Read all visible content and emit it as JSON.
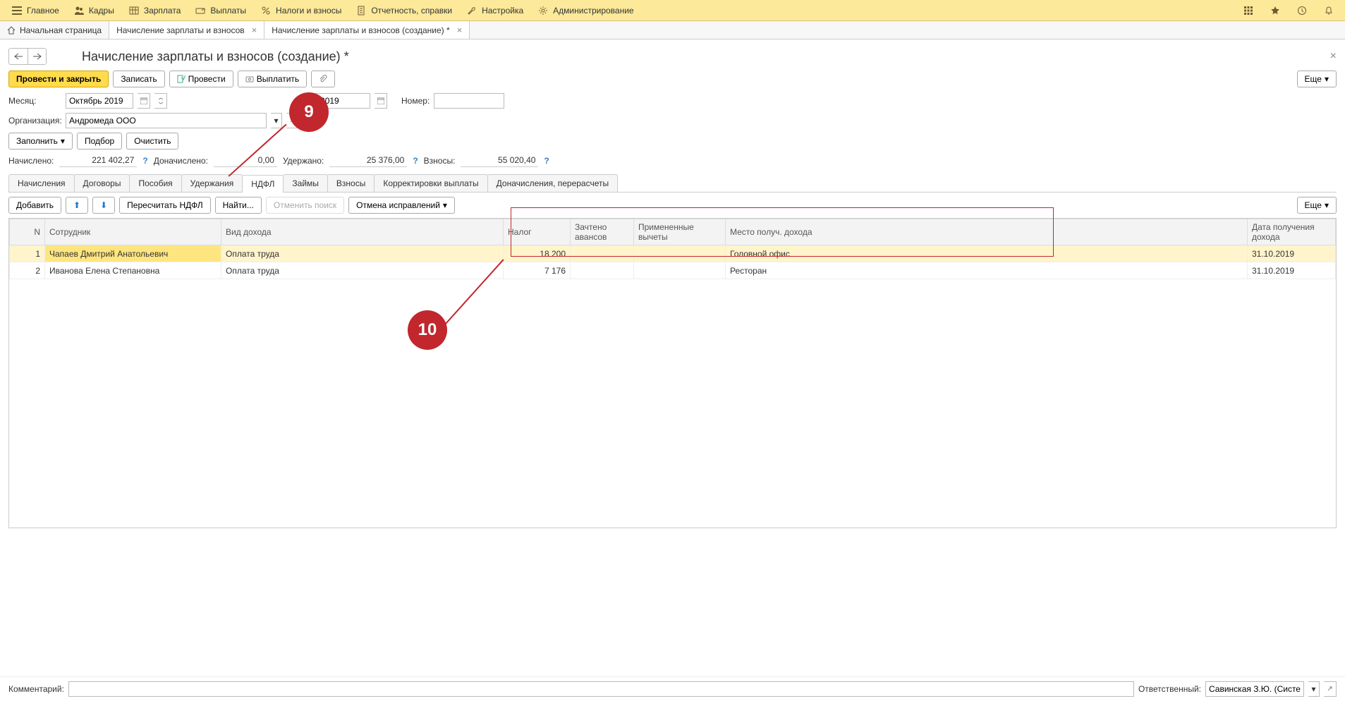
{
  "topMenu": {
    "items": [
      {
        "label": "Главное"
      },
      {
        "label": "Кадры"
      },
      {
        "label": "Зарплата"
      },
      {
        "label": "Выплаты"
      },
      {
        "label": "Налоги и взносы"
      },
      {
        "label": "Отчетность, справки"
      },
      {
        "label": "Настройка"
      },
      {
        "label": "Администрирование"
      }
    ]
  },
  "tabs": {
    "home": "Начальная страница",
    "items": [
      {
        "label": "Начисление зарплаты и взносов"
      },
      {
        "label": "Начисление зарплаты и взносов (создание) *"
      }
    ]
  },
  "page": {
    "title": "Начисление зарплаты и взносов (создание) *"
  },
  "toolbar": {
    "postClose": "Провести и закрыть",
    "write": "Записать",
    "post": "Провести",
    "payout": "Выплатить",
    "more": "Еще"
  },
  "form": {
    "monthLabel": "Месяц:",
    "monthValue": "Октябрь 2019",
    "dateValue": ".10.2019",
    "numberLabel": "Номер:",
    "numberValue": "",
    "orgLabel": "Организация:",
    "orgValue": "Андромеда ООО",
    "fillBtn": "Заполнить",
    "pickBtn": "Подбор",
    "clearBtn": "Очистить"
  },
  "totals": {
    "accruedLabel": "Начислено:",
    "accruedValue": "221 402,27",
    "extraAccruedLabel": "Доначислено:",
    "extraAccruedValue": "0,00",
    "withheldLabel": "Удержано:",
    "withheldValue": "25 376,00",
    "contribLabel": "Взносы:",
    "contribValue": "55 020,40"
  },
  "innerTabs": {
    "items": [
      "Начисления",
      "Договоры",
      "Пособия",
      "Удержания",
      "НДФЛ",
      "Займы",
      "Взносы",
      "Корректировки выплаты",
      "Доначисления, перерасчеты"
    ],
    "activeIndex": 4
  },
  "subToolbar": {
    "add": "Добавить",
    "recalc": "Пересчитать НДФЛ",
    "find": "Найти...",
    "cancelSearch": "Отменить поиск",
    "cancelFix": "Отмена исправлений",
    "more": "Еще"
  },
  "table": {
    "headers": {
      "n": "N",
      "employee": "Сотрудник",
      "incomeType": "Вид дохода",
      "tax": "Налог",
      "advanceOffset": "Зачтено авансов",
      "deductions": "Примененные вычеты",
      "incomePlace": "Место получ. дохода",
      "incomeDate": "Дата получения дохода"
    },
    "rows": [
      {
        "n": "1",
        "employee": "Чапаев Дмитрий Анатольевич",
        "incomeType": "Оплата труда",
        "tax": "18 200",
        "advanceOffset": "",
        "deductions": "",
        "incomePlace": "Головной офис",
        "incomeDate": "31.10.2019"
      },
      {
        "n": "2",
        "employee": "Иванова Елена Степановна",
        "incomeType": "Оплата труда",
        "tax": "7 176",
        "advanceOffset": "",
        "deductions": "",
        "incomePlace": "Ресторан",
        "incomeDate": "31.10.2019"
      }
    ]
  },
  "footer": {
    "commentLabel": "Комментарий:",
    "commentValue": "",
    "respLabel": "Ответственный:",
    "respValue": "Савинская З.Ю. (Системн"
  },
  "annotations": {
    "c9": "9",
    "c10": "10"
  }
}
